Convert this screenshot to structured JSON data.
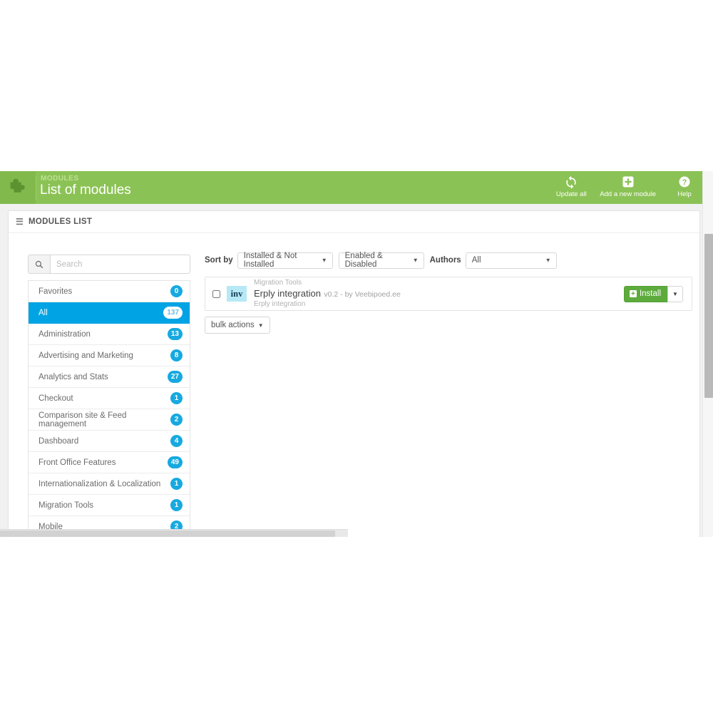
{
  "header": {
    "kicker": "MODULES",
    "title": "List of modules",
    "puzzle_icon": "puzzle-icon",
    "actions": [
      {
        "id": "update-all",
        "label": "Update all",
        "icon": "refresh-icon"
      },
      {
        "id": "add-new-module",
        "label": "Add a new module",
        "icon": "plus-square-icon"
      },
      {
        "id": "help",
        "label": "Help",
        "icon": "question-circle-icon"
      }
    ]
  },
  "panel": {
    "title": "MODULES LIST",
    "icon": "list-icon"
  },
  "sidebar": {
    "search": {
      "placeholder": "Search",
      "value": "",
      "icon": "search-icon"
    },
    "categories": [
      {
        "label": "Favorites",
        "count": "0",
        "active": false
      },
      {
        "label": "All",
        "count": "137",
        "active": true
      },
      {
        "label": "Administration",
        "count": "13",
        "active": false
      },
      {
        "label": "Advertising and Marketing",
        "count": "8",
        "active": false
      },
      {
        "label": "Analytics and Stats",
        "count": "27",
        "active": false
      },
      {
        "label": "Checkout",
        "count": "1",
        "active": false
      },
      {
        "label": "Comparison site & Feed management",
        "count": "2",
        "active": false
      },
      {
        "label": "Dashboard",
        "count": "4",
        "active": false
      },
      {
        "label": "Front Office Features",
        "count": "49",
        "active": false
      },
      {
        "label": "Internationalization & Localization",
        "count": "1",
        "active": false
      },
      {
        "label": "Migration Tools",
        "count": "1",
        "active": false
      },
      {
        "label": "Mobile",
        "count": "2",
        "active": false
      }
    ]
  },
  "toolbar": {
    "sort_by_label": "Sort by",
    "installed_filter": "Installed & Not Installed",
    "enabled_filter": "Enabled & Disabled",
    "authors_label": "Authors",
    "authors_filter": "All",
    "caret_icon": "chevron-down-icon"
  },
  "modules": [
    {
      "category": "Migration Tools",
      "name": "Erply integration",
      "meta": "v0.2 - by Veebipoed.ee",
      "description": "Erply integration",
      "icon_text": "inv",
      "icon_name": "module-thumbnail",
      "install_label": "Install",
      "install_icon": "plus-icon",
      "checkbox_checked": false
    }
  ],
  "bulk": {
    "label": "bulk actions",
    "caret_icon": "chevron-down-icon"
  },
  "colors": {
    "header_green": "#8bc255",
    "header_green_dark": "#82b94d",
    "active_blue": "#00a4e4",
    "badge_blue": "#17a9e0",
    "install_green": "#5cab3c",
    "module_icon_bg": "#b6e9f5"
  }
}
